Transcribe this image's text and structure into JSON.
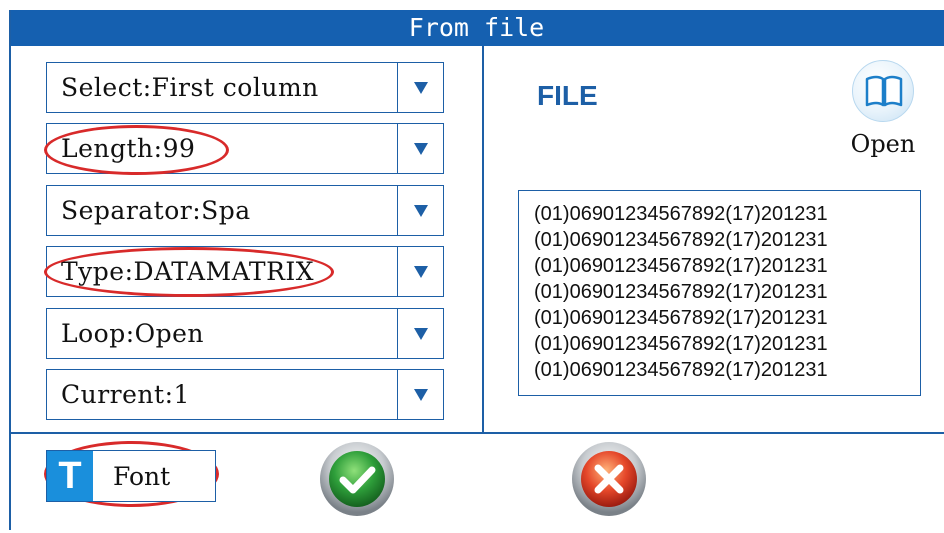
{
  "window": {
    "title": "From file"
  },
  "settings": {
    "select": "Select:First column",
    "length": "Length:99",
    "separator": "Separator:Spa",
    "type": "Type:DATAMATRIX",
    "loop": "Loop:Open",
    "current": "Current:1"
  },
  "file_panel": {
    "label": "FILE",
    "open_label": "Open",
    "rows": [
      "(01)06901234567892(17)201231",
      "(01)06901234567892(17)201231",
      "(01)06901234567892(17)201231",
      "(01)06901234567892(17)201231",
      "(01)06901234567892(17)201231",
      "(01)06901234567892(17)201231",
      "(01)06901234567892(17)201231"
    ]
  },
  "footer": {
    "font_icon_letter": "T",
    "font_label": "Font"
  },
  "colors": {
    "accent": "#1560b0",
    "highlight": "#d82a2a",
    "confirm": "#2e9e3a",
    "cancel": "#e5472a"
  },
  "icons": {
    "open": "book-icon",
    "confirm": "check-icon",
    "cancel": "close-icon",
    "dropdown": "triangle-down-icon"
  }
}
